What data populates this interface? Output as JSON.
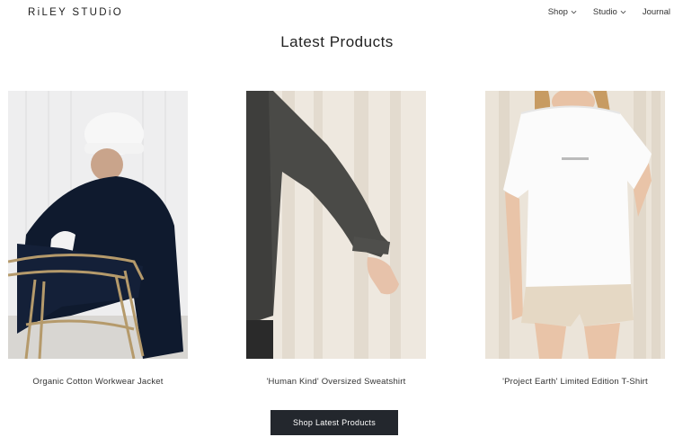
{
  "header": {
    "logo": "RiLEY STUDiO",
    "nav": [
      {
        "label": "Shop",
        "has_dropdown": true
      },
      {
        "label": "Studio",
        "has_dropdown": true
      },
      {
        "label": "Journal",
        "has_dropdown": false
      }
    ]
  },
  "section": {
    "title": "Latest Products"
  },
  "products": [
    {
      "name": "Organic Cotton Workwear Jacket"
    },
    {
      "name": "'Human Kind' Oversized Sweatshirt"
    },
    {
      "name": "'Project Earth' Limited Edition T-Shirt"
    }
  ],
  "cta": {
    "label": "Shop Latest Products"
  },
  "colors": {
    "button_bg": "#23272d",
    "text": "#2b2b2b",
    "background": "#ffffff"
  }
}
